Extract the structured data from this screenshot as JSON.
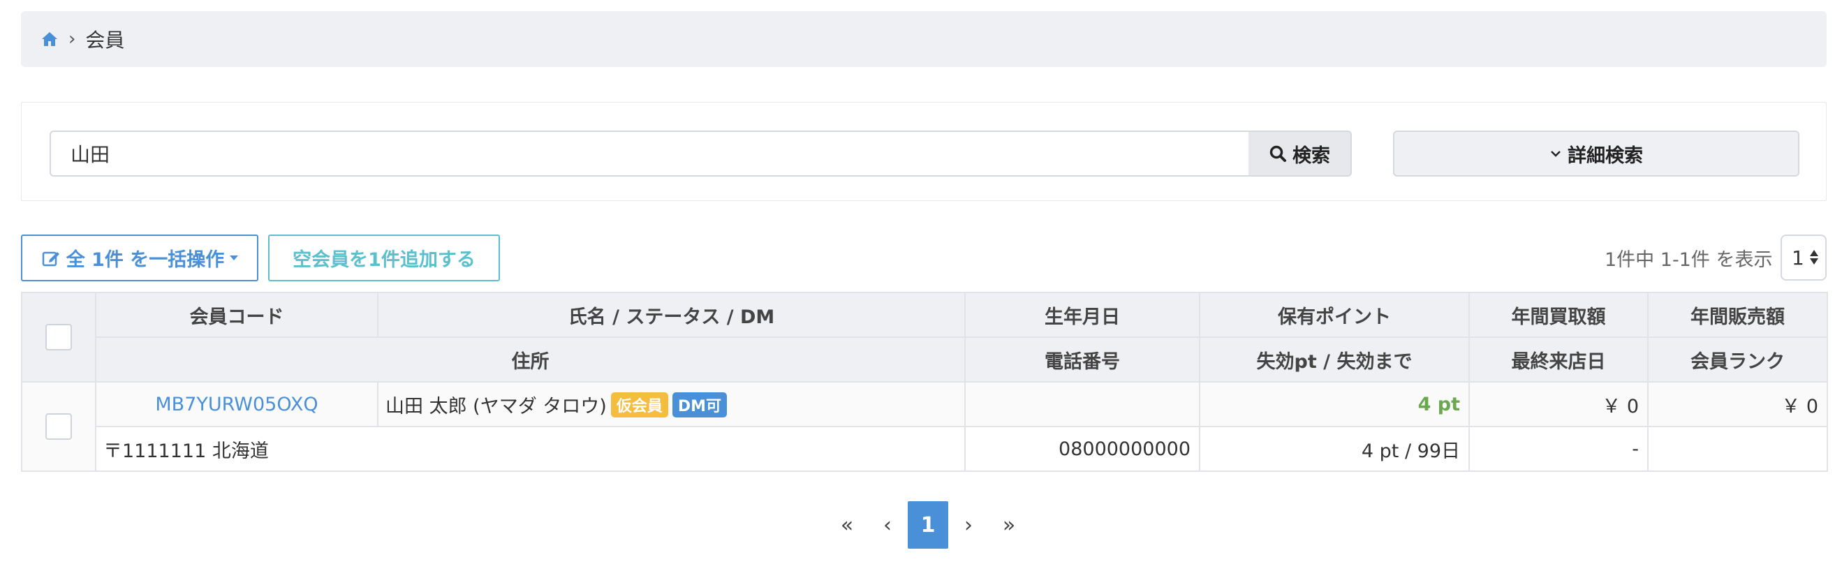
{
  "breadcrumb": {
    "current": "会員"
  },
  "search": {
    "value": "山田",
    "button_label": "検索",
    "advanced_label": "詳細検索"
  },
  "toolbar": {
    "bulk_label": "全 1件 を一括操作",
    "add_label": "空会員を1件追加する",
    "count_text": "1件中 1-1件 を表示",
    "per_page": "1"
  },
  "table": {
    "headers_row1": [
      "会員コード",
      "氏名 / ステータス / DM",
      "生年月日",
      "保有ポイント",
      "年間買取額",
      "年間販売額"
    ],
    "headers_row2": [
      "住所",
      "電話番号",
      "失効pt / 失効まで",
      "最終来店日",
      "会員ランク"
    ],
    "rows": [
      {
        "code": "MB7YURW05OXQ",
        "name": "山田 太郎 (ヤマダ タロウ)",
        "status_badge": "仮会員",
        "dm_badge": "DM可",
        "birthday": "",
        "points": "4 pt",
        "annual_purchase": "￥ 0",
        "annual_sales": "￥ 0",
        "address": "〒1111111 北海道",
        "phone": "08000000000",
        "expiring": "4 pt / 99日",
        "last_visit": "-",
        "rank": ""
      }
    ]
  },
  "pagination": {
    "first": "«",
    "prev": "‹",
    "current": "1",
    "next": "›",
    "last": "»"
  },
  "colors": {
    "accent": "#4a90d9",
    "info": "#5bc0cd",
    "warning": "#f5bd3d",
    "success": "#6aa84f"
  }
}
